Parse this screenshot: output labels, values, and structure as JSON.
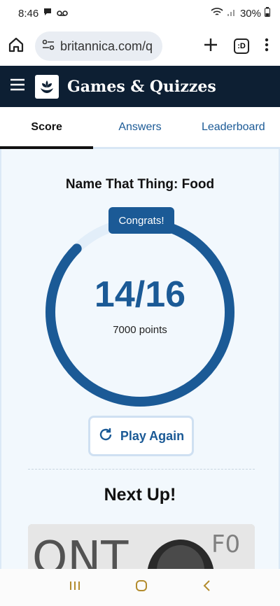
{
  "status": {
    "time": "8:46",
    "battery": "30%"
  },
  "browser": {
    "url": "britannica.com/q",
    "tab_count": ":D"
  },
  "header": {
    "brand": "Games & Quizzes"
  },
  "tabs": [
    {
      "label": "Score",
      "active": true
    },
    {
      "label": "Answers",
      "active": false
    },
    {
      "label": "Leaderboard",
      "active": false
    }
  ],
  "result": {
    "quiz_title": "Name That Thing: Food",
    "badge": "Congrats!",
    "score": "14/16",
    "points": "7000 points",
    "fraction_correct": 0.875,
    "play_again_label": "Play Again"
  },
  "next": {
    "heading": "Next Up!"
  },
  "colors": {
    "accent": "#1b5a96",
    "header_bg": "#0d1f33",
    "panel_bg": "#f2f8fd"
  },
  "icons": [
    "home-icon",
    "site-settings-icon",
    "plus-icon",
    "tab-switcher-icon",
    "more-vert-icon",
    "menu-icon",
    "britannica-logo",
    "refresh-icon",
    "recents-icon",
    "home-circle-icon",
    "back-icon"
  ]
}
